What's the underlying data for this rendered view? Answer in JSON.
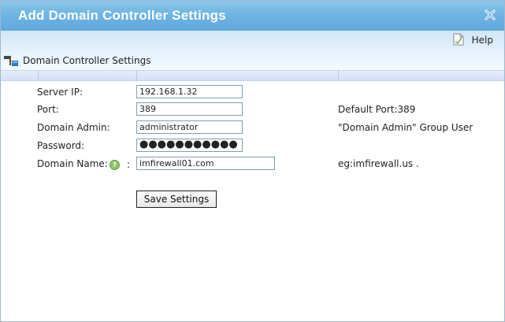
{
  "dialog": {
    "title": "Add Domain Controller Settings",
    "close_icon": "close-x-icon",
    "help_label": "Help",
    "help_icon": "help-document-icon"
  },
  "section": {
    "title": "Domain Controller Settings",
    "icon": "hammer-tool-icon"
  },
  "form": {
    "server_ip": {
      "label": "Server IP:",
      "value": "192.168.1.32"
    },
    "port": {
      "label": "Port:",
      "value": "389",
      "note": "Default Port:389"
    },
    "domain_admin": {
      "label": "Domain Admin:",
      "value": "administrator",
      "note": "\"Domain Admin\" Group User"
    },
    "password": {
      "label": "Password:",
      "value": "●●●●●●●●●●●"
    },
    "domain_name": {
      "label": "Domain Name:",
      "colon": ":",
      "value": "imfirewall01.com",
      "note": "eg:imfirewall.us .",
      "help_icon": "question-mark-icon"
    }
  },
  "buttons": {
    "save_label": "Save Settings"
  },
  "colors": {
    "title_bar": "#6fb4e3",
    "header_band": "#cfe6f6",
    "stripe": "#d4def4"
  }
}
